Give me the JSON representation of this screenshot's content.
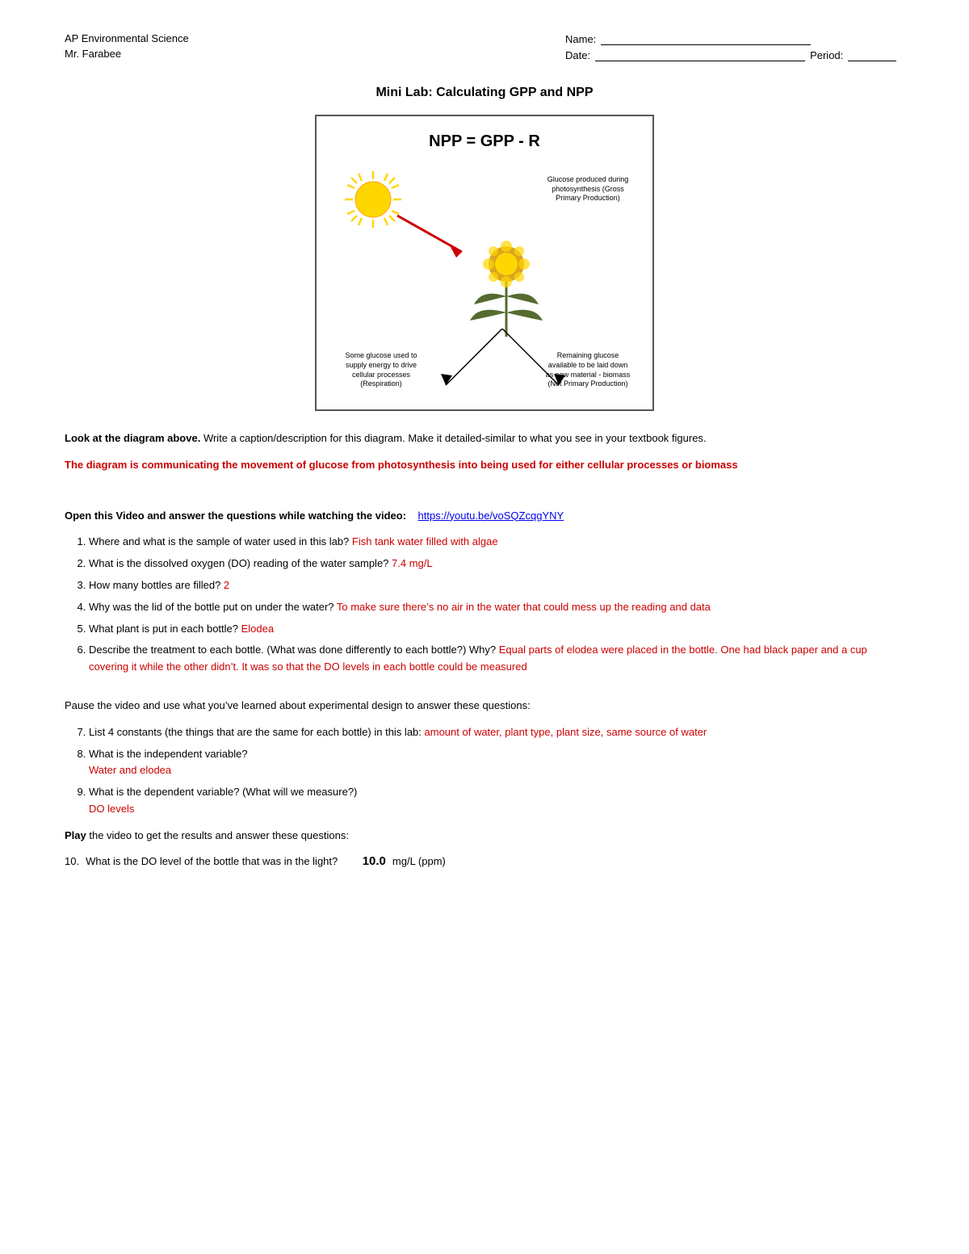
{
  "header": {
    "course": "AP Environmental Science",
    "teacher": "Mr. Farabee",
    "name_label": "Name:",
    "date_label": "Date:",
    "period_label": "Period:"
  },
  "title": "Mini Lab: Calculating GPP and NPP",
  "diagram": {
    "formula": "NPP = GPP - R",
    "label_top": "Glucose produced during photosynthesis (Gross Primary Production)",
    "label_bottom_left": "Some glucose used to supply energy to drive cellular processes (Respiration)",
    "label_bottom_right": "Remaining glucose available to be laid down as new material - biomass (Net Primary Production)"
  },
  "section1": {
    "prompt": "Look at the diagram above.",
    "prompt_rest": " Write a caption/description for this diagram. Make it detailed-similar to what you see in your textbook figures.",
    "answer": "The diagram is communicating the movement of glucose from photosynthesis into being used for either cellular processes or biomass"
  },
  "section2": {
    "prompt": "Open this Video and answer the questions while watching the video:",
    "link_text": "https://youtu.be/voSQZcqgYNY",
    "link_url": "https://youtu.be/voSQZcqgYNY",
    "questions": [
      {
        "num": 1,
        "text": "Where and what is the sample of water used in this lab?",
        "answer": "Fish tank water filled with algae"
      },
      {
        "num": 2,
        "text": "What is the dissolved oxygen (DO) reading of the water sample?",
        "answer": "7.4 mg/L"
      },
      {
        "num": 3,
        "text": "How many bottles are filled?",
        "answer": "2"
      },
      {
        "num": 4,
        "text": "Why was the lid of the bottle put on under the water?",
        "answer": "To make sure there’s no air in the water that could mess up the reading and data"
      },
      {
        "num": 5,
        "text": "What plant is put in each bottle?",
        "answer": "Elodea"
      },
      {
        "num": 6,
        "text": "Describe the treatment to each bottle. (What was done differently to each bottle?) Why?",
        "answer": "Equal parts of elodea were placed in the bottle. One had black paper and a cup covering it while the other didn’t. It was so that the DO levels in each bottle could be measured"
      }
    ]
  },
  "section3": {
    "intro": "Pause the video and use what you’ve learned about experimental design to answer these questions:",
    "questions": [
      {
        "num": 7,
        "text": "List 4 constants (the things that are the same for each bottle) in this lab:",
        "answer": "amount of water, plant type, plant size, same source of water"
      },
      {
        "num": 8,
        "text": "What is the independent variable?",
        "answer": "Water and elodea"
      },
      {
        "num": 9,
        "text": "What is the dependent variable? (What will we measure?)",
        "answer": "DO levels"
      }
    ]
  },
  "section4": {
    "play_label": "Play",
    "play_rest": " the video to get the results and answer these questions:",
    "q10": {
      "num": "10.",
      "text": "What is the DO level of the bottle that was in the light?",
      "answer": "10.0",
      "unit": "mg/L (ppm)"
    }
  }
}
